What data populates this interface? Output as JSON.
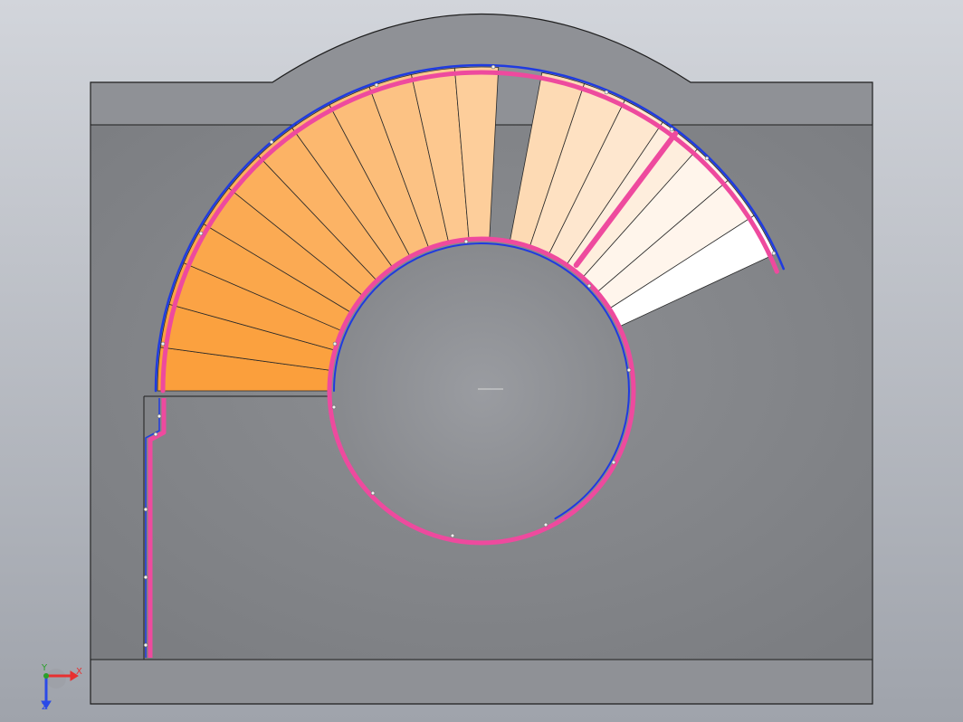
{
  "viewport": {
    "background_gradient": [
      "#d2d5db",
      "#9fa3ab"
    ],
    "model": {
      "frame_color": "#8f9196",
      "panel_color": "#85878b",
      "edge_color": "#1e1e1e",
      "stair_gradient": [
        "#fb9f3c",
        "#ffffff"
      ],
      "handrail_color": "#ee4a9e",
      "stringer_color": "#1f3be0"
    },
    "triad": {
      "x_label": "X",
      "y_label": "Y",
      "z_label": "Z",
      "x_color": "#e83030",
      "y_color": "#2aa02a",
      "z_color": "#2a4ae8"
    }
  }
}
